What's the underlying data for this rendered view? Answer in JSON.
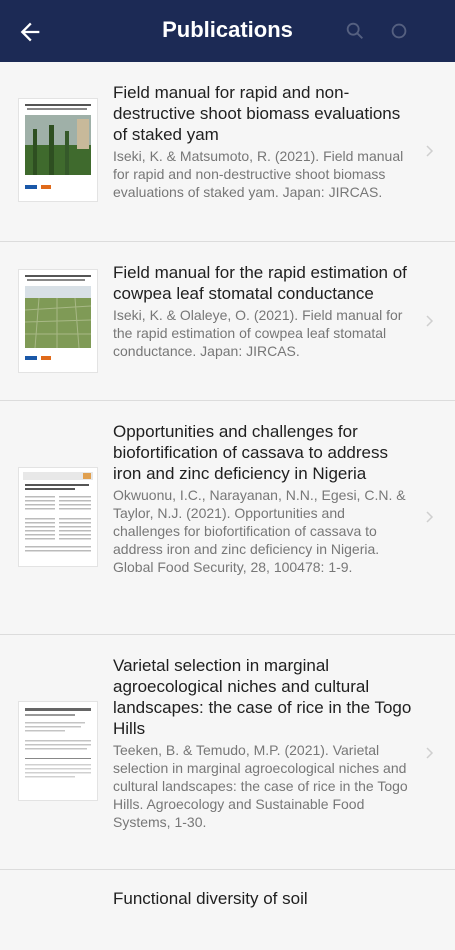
{
  "header": {
    "title": "Publications"
  },
  "publications": [
    {
      "title": "Field manual for rapid and non-destructive shoot biomass evaluations of staked yam",
      "citation": "Iseki, K. & Matsumoto, R. (2021). Field manual for rapid and non-destructive shoot biomass evaluations of staked yam. Japan: JIRCAS."
    },
    {
      "title": "Field manual for the rapid estimation of cowpea leaf stomatal conductance",
      "citation": "Iseki, K. & Olaleye, O. (2021). Field manual for the rapid estimation of cowpea leaf stomatal conductance. Japan: JIRCAS."
    },
    {
      "title": "Opportunities and challenges for biofortification of cassava to address iron and zinc deficiency in Nigeria",
      "citation": "Okwuonu, I.C., Narayanan, N.N., Egesi, C.N. & Taylor, N.J. (2021). Opportunities and challenges for biofortification of cassava to address iron and zinc deficiency in Nigeria. Global Food Security, 28, 100478: 1-9."
    },
    {
      "title": "Varietal selection in marginal agroecological niches and cultural landscapes: the case of rice in the Togo Hills",
      "citation": "Teeken, B. & Temudo, M.P. (2021). Varietal selection in marginal agroecological niches and cultural landscapes: the case of rice in the Togo Hills. Agroecology and Sustainable Food Systems, 1-30."
    },
    {
      "title": "Functional diversity of soil",
      "citation": ""
    }
  ]
}
